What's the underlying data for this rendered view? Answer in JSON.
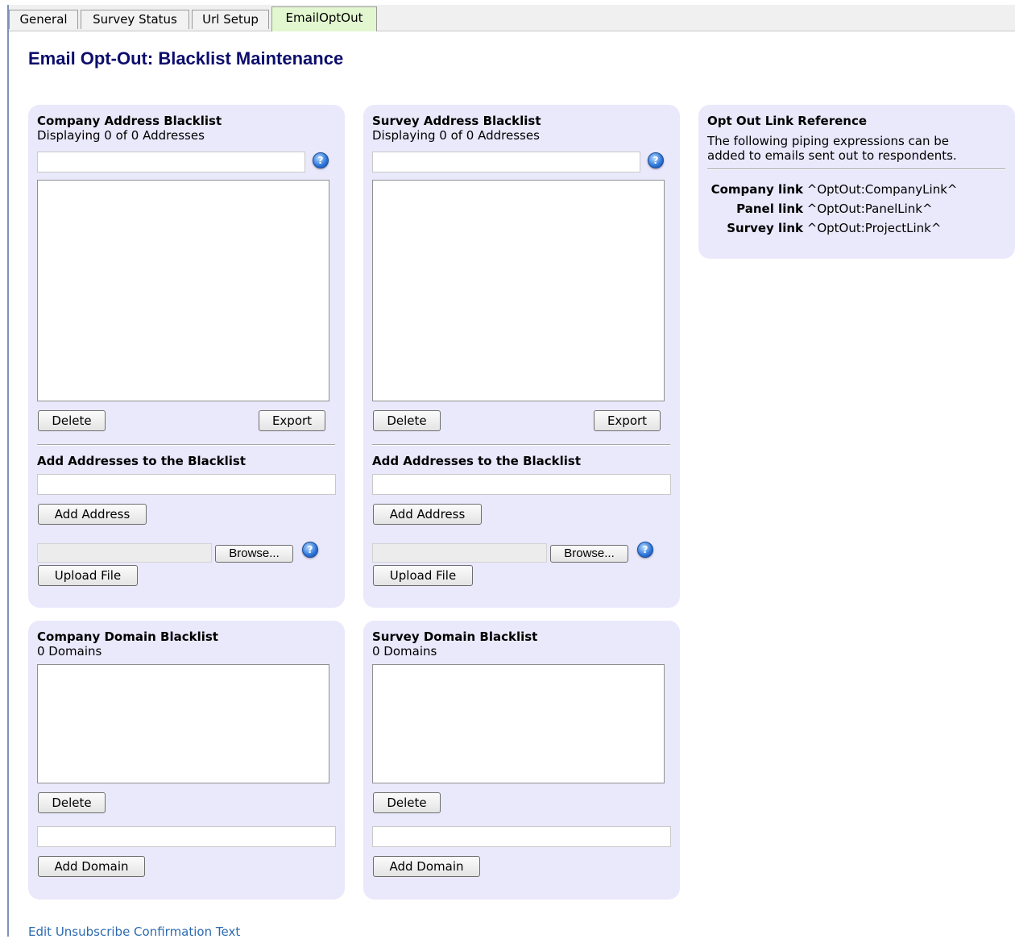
{
  "tabs": [
    {
      "label": "General",
      "active": false
    },
    {
      "label": "Survey Status",
      "active": false
    },
    {
      "label": "Url Setup",
      "active": false
    },
    {
      "label": "EmailOptOut",
      "active": true
    }
  ],
  "page_title": "Email Opt-Out: Blacklist Maintenance",
  "company_address": {
    "title": "Company Address Blacklist",
    "count_text": "Displaying 0 of 0 Addresses",
    "filter_value": "",
    "delete_label": "Delete",
    "export_label": "Export",
    "add_heading": "Add Addresses to the Blacklist",
    "add_value": "",
    "add_label": "Add Address",
    "browse_label": "Browse...",
    "upload_label": "Upload File"
  },
  "survey_address": {
    "title": "Survey Address Blacklist",
    "count_text": "Displaying 0 of 0 Addresses",
    "filter_value": "",
    "delete_label": "Delete",
    "export_label": "Export",
    "add_heading": "Add Addresses to the Blacklist",
    "add_value": "",
    "add_label": "Add Address",
    "browse_label": "Browse...",
    "upload_label": "Upload File"
  },
  "company_domain": {
    "title": "Company Domain Blacklist",
    "count_text": "0 Domains",
    "delete_label": "Delete",
    "add_value": "",
    "add_label": "Add Domain"
  },
  "survey_domain": {
    "title": "Survey Domain Blacklist",
    "count_text": "0 Domains",
    "delete_label": "Delete",
    "add_value": "",
    "add_label": "Add Domain"
  },
  "reference": {
    "title": "Opt Out Link Reference",
    "desc_line1": "The following piping expressions can be",
    "desc_line2": "added to emails sent out to respondents.",
    "rows": [
      {
        "label": "Company link",
        "value": "^OptOut:CompanyLink^"
      },
      {
        "label": "Panel link",
        "value": "^OptOut:PanelLink^"
      },
      {
        "label": "Survey link",
        "value": "^OptOut:ProjectLink^"
      }
    ]
  },
  "help_icon": "help-question-icon",
  "footer_link": "Edit Unsubscribe Confirmation Text",
  "colors": {
    "panel_bg": "#eae8fb",
    "title": "#0c0d6c",
    "active_tab": "#e2f7cf",
    "link": "#2c6bb0"
  }
}
